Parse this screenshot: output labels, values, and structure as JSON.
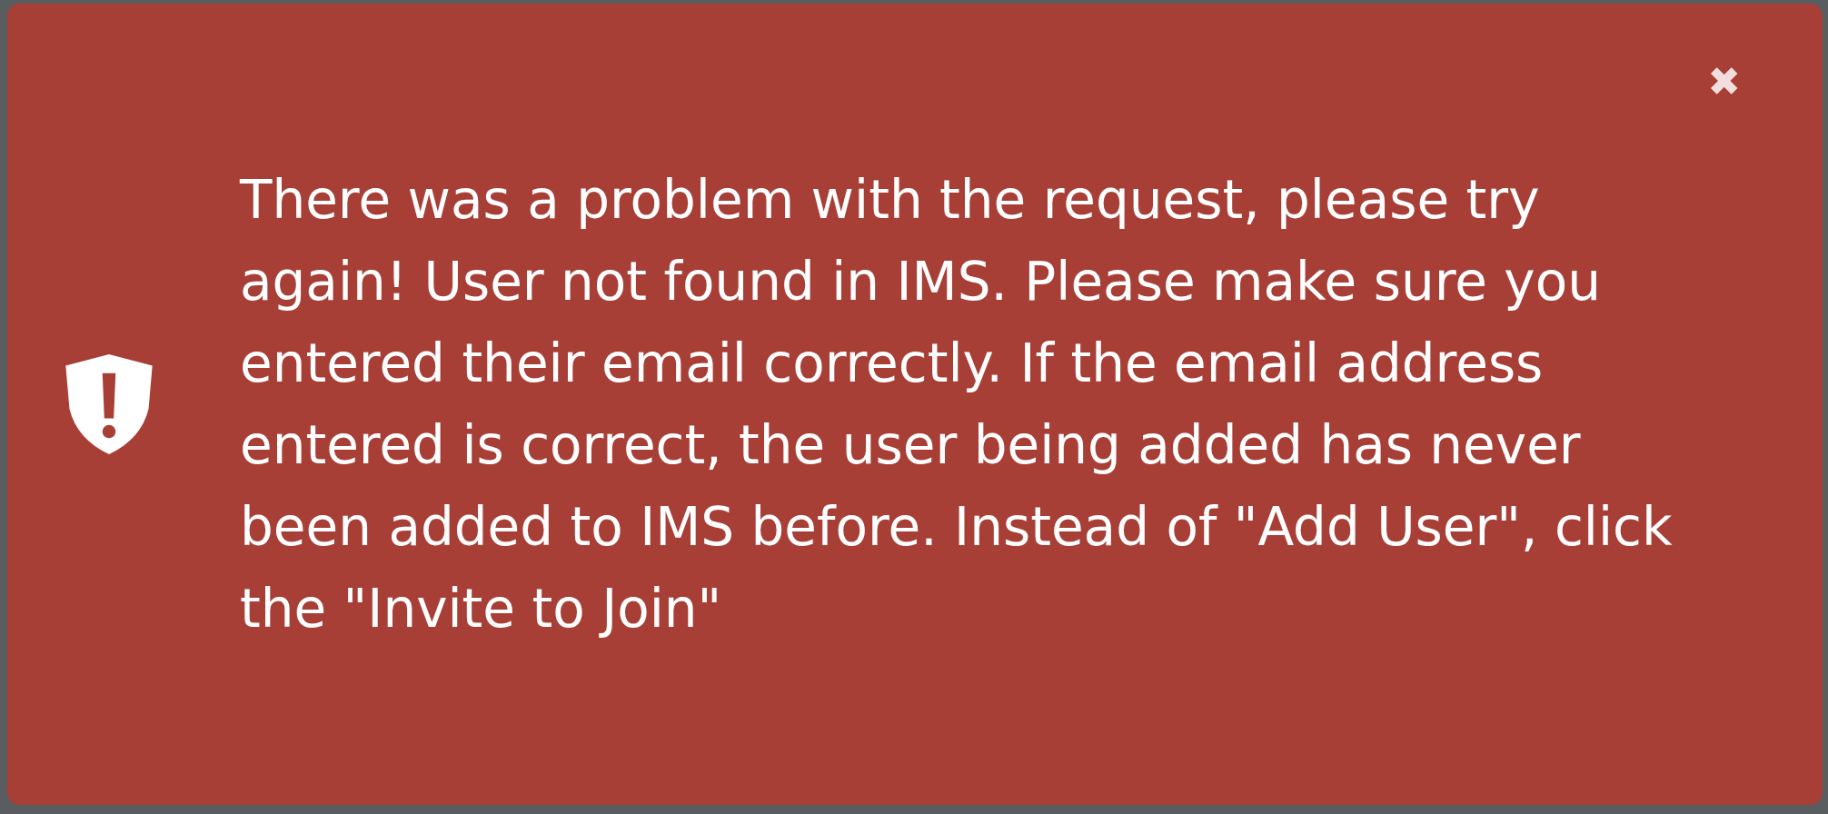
{
  "alert": {
    "kind": "error",
    "message": "There was a problem with the request, please try again! User not found in IMS. Please make sure you entered their email correctly. If the email address entered is correct, the user being added has never been added to IMS before. Instead of \"Add User\", click the \"Invite to Join\"",
    "close": "✖"
  }
}
